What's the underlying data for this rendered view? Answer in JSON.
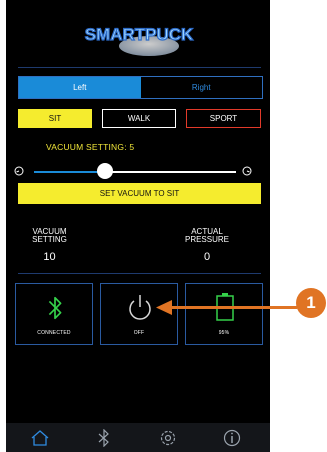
{
  "brand": {
    "logo_text": "SMARTPUCK"
  },
  "side_tabs": [
    {
      "label": "Left",
      "selected": true
    },
    {
      "label": "Right",
      "selected": false
    }
  ],
  "modes": [
    {
      "label": "SIT",
      "selected": true,
      "border": "#f5ec2e"
    },
    {
      "label": "WALK",
      "selected": false,
      "border": "#ffffff"
    },
    {
      "label": "SPORT",
      "selected": false,
      "border": "#e23a2a"
    }
  ],
  "vacuum": {
    "setting_label": "VACUUM SETTING: 5",
    "level_fraction": 0.35
  },
  "set_button": {
    "label": "SET VACUUM TO SIT"
  },
  "stats": {
    "vacuum_setting": {
      "line1": "VACUUM",
      "line2": "SETTING",
      "value": "10"
    },
    "actual_pressure": {
      "line1": "ACTUAL",
      "line2": "PRESSURE",
      "value": "0"
    }
  },
  "tiles": {
    "bluetooth": {
      "caption": "CONNECTED",
      "icon": "bluetooth-icon"
    },
    "power": {
      "caption": "OFF",
      "icon": "power-icon"
    },
    "battery": {
      "caption": "95%",
      "icon": "battery-icon"
    }
  },
  "nav": [
    "home-icon",
    "bluetooth-icon",
    "settings-icon",
    "info-icon"
  ],
  "callout": {
    "number": "1"
  },
  "colors": {
    "accent_blue": "#1a8bd8",
    "yellow": "#f5ec2e",
    "green": "#35d14a",
    "callout_orange": "#e07424"
  }
}
